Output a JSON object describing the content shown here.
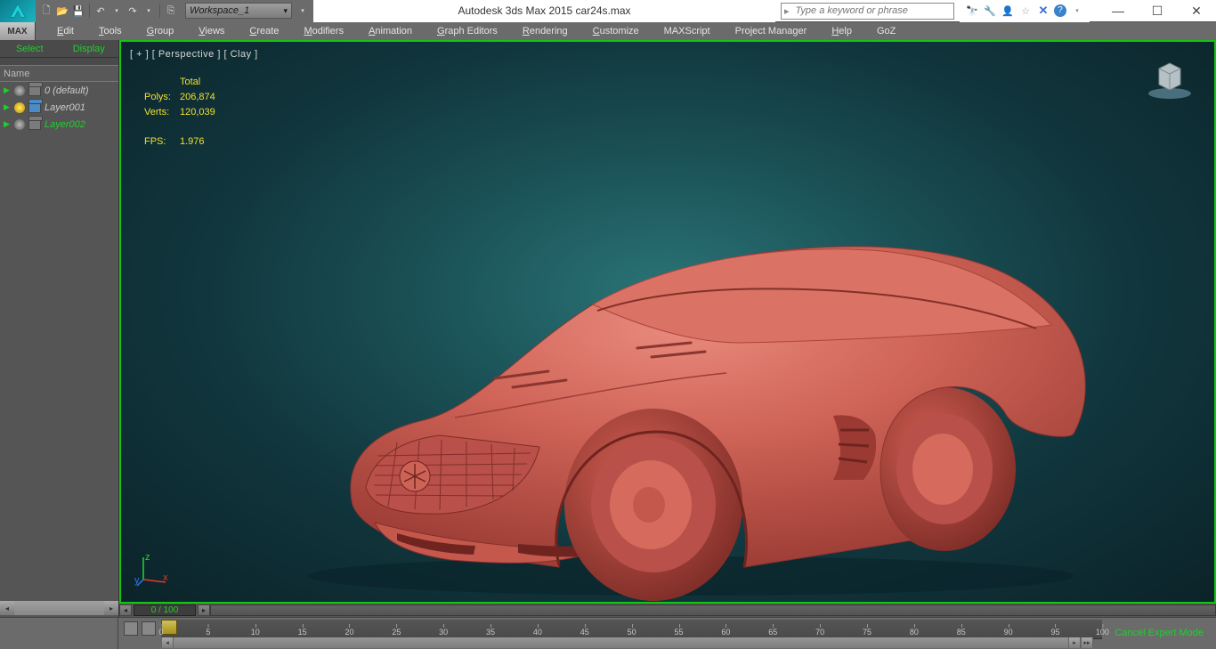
{
  "app": {
    "title": "Autodesk 3ds Max  2015    car24s.max",
    "workspace": "Workspace_1",
    "search_placeholder": "Type a keyword or phrase",
    "max_badge": "MAX"
  },
  "menus": [
    "Edit",
    "Tools",
    "Group",
    "Views",
    "Create",
    "Modifiers",
    "Animation",
    "Graph Editors",
    "Rendering",
    "Customize",
    "MAXScript",
    "Project Manager",
    "Help",
    "GoZ"
  ],
  "side_tabs": {
    "select": "Select",
    "display": "Display"
  },
  "layer_header": "Name",
  "layers": [
    {
      "name": "0 (default)",
      "bulb": "off",
      "active": false
    },
    {
      "name": "Layer001",
      "bulb": "on",
      "active": false
    },
    {
      "name": "Layer002",
      "bulb": "off",
      "active": true
    }
  ],
  "viewport": {
    "label": "[ + ] [ Perspective ] [ Clay ]",
    "stats": {
      "total_label": "Total",
      "polys_label": "Polys:",
      "polys": "206,874",
      "verts_label": "Verts:",
      "verts": "120,039",
      "fps_label": "FPS:",
      "fps": "1.976"
    }
  },
  "timeline": {
    "frame_display": "0 / 100",
    "ticks": [
      0,
      5,
      10,
      15,
      20,
      25,
      30,
      35,
      40,
      45,
      50,
      55,
      60,
      65,
      70,
      75,
      80,
      85,
      90,
      95,
      100
    ]
  },
  "expert_mode": "Cancel Expert Mode"
}
